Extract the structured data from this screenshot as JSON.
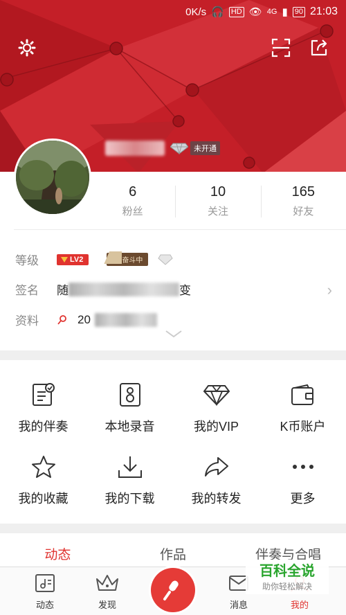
{
  "status_bar": {
    "speed": "0K/s",
    "hd": "HD",
    "network": "4G",
    "battery": "90",
    "time": "21:03"
  },
  "profile": {
    "vip_status": "未开通",
    "stats": [
      {
        "value": "6",
        "label": "粉丝"
      },
      {
        "value": "10",
        "label": "关注"
      },
      {
        "value": "165",
        "label": "好友"
      }
    ],
    "info": {
      "level_key": "等级",
      "level_badge": "LV2",
      "rank_badge": "奋斗中",
      "signature_key": "签名",
      "signature_visible_start": "随",
      "signature_visible_end": "变",
      "data_key": "资料",
      "data_visible": "20"
    }
  },
  "menu": {
    "row1": [
      {
        "label": "我的伴奏",
        "icon": "accompaniment-icon"
      },
      {
        "label": "本地录音",
        "icon": "local-recording-icon"
      },
      {
        "label": "我的VIP",
        "icon": "vip-diamond-icon"
      },
      {
        "label": "K币账户",
        "icon": "wallet-icon"
      }
    ],
    "row2": [
      {
        "label": "我的收藏",
        "icon": "star-icon"
      },
      {
        "label": "我的下载",
        "icon": "download-icon"
      },
      {
        "label": "我的转发",
        "icon": "share-arrow-icon"
      },
      {
        "label": "更多",
        "icon": "more-icon"
      }
    ]
  },
  "tabs": [
    "动态",
    "作品",
    "伴奏与合唱"
  ],
  "bottom_nav": [
    {
      "label": "动态",
      "icon": "feed-icon"
    },
    {
      "label": "发现",
      "icon": "crown-icon"
    },
    {
      "label": "消息",
      "icon": "message-icon"
    },
    {
      "label": "我的",
      "icon": "profile-icon"
    }
  ],
  "watermark": {
    "title": "百科全说",
    "subtitle": "助你轻松解决"
  },
  "colors": {
    "header_red": "#c41f28",
    "accent_red": "#e0332f",
    "watermark_green": "#2aa52e"
  }
}
